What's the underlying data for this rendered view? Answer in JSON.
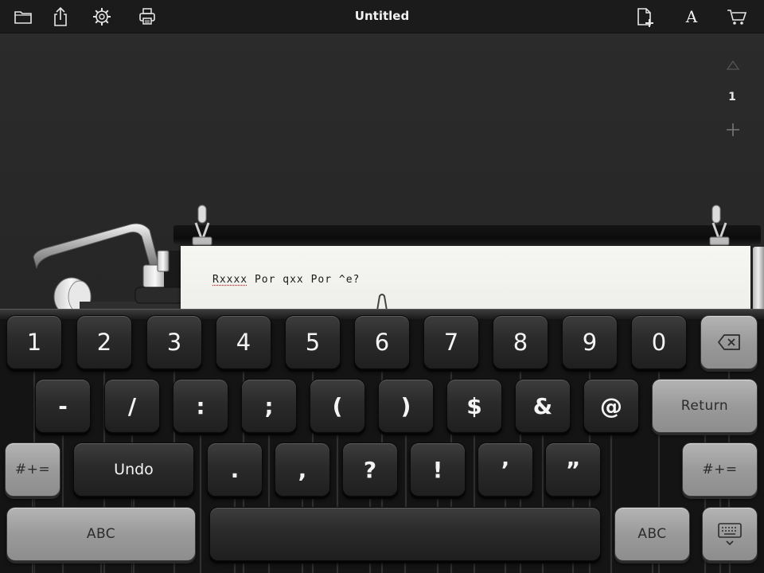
{
  "toolbar": {
    "title": "Untitled",
    "font_button": "A",
    "icons": [
      "folder-icon",
      "share-icon",
      "gear-icon",
      "printer-icon",
      "new-page-icon",
      "font-icon",
      "cart-icon"
    ]
  },
  "page_nav": {
    "page_number": "1"
  },
  "paper": {
    "misspelled_word": "Rxxxx",
    "text_rest": " Por qxx Por ^e?"
  },
  "keyboard": {
    "row1": [
      "1",
      "2",
      "3",
      "4",
      "5",
      "6",
      "7",
      "8",
      "9",
      "0"
    ],
    "row2": [
      "-",
      "/",
      ":",
      ";",
      "(",
      ")",
      "$",
      "&",
      "@"
    ],
    "row3": [
      ".",
      ",",
      "?",
      "!",
      "’",
      "”"
    ],
    "return_label": "Return",
    "undo_label": "Undo",
    "symbols_left": "#+=",
    "symbols_right": "#+=",
    "abc_left": "ABC",
    "abc_right": "ABC",
    "icons": [
      "backspace-icon",
      "keyboard-dismiss-icon"
    ]
  },
  "colors": {
    "keyboard_bg": "#141414",
    "dark_key": "#2a2a2a",
    "light_key": "#9a9a9a",
    "paper": "#f2f2ef"
  }
}
